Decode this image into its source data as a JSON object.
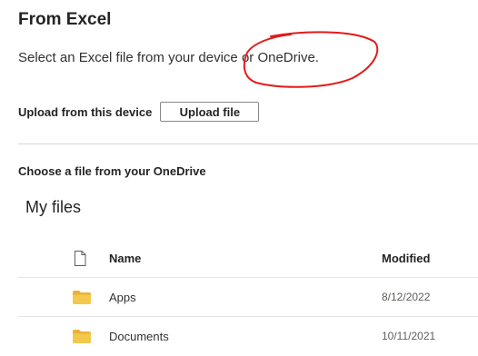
{
  "dialog": {
    "title": "From Excel",
    "subtitle": "Select an Excel file from your device or OneDrive."
  },
  "upload": {
    "label": "Upload from this device",
    "button_label": "Upload file"
  },
  "onedrive": {
    "choose_label": "Choose a file from your OneDrive",
    "section_title": "My files",
    "columns": {
      "name": "Name",
      "modified": "Modified"
    },
    "files": [
      {
        "name": "Apps",
        "modified": "8/12/2022",
        "icon": "folder-icon"
      },
      {
        "name": "Documents",
        "modified": "10/11/2021",
        "icon": "folder-icon"
      }
    ]
  },
  "colors": {
    "annotation": "#e21b1b",
    "folder": "#f2c94c",
    "folder_dark": "#e8b339",
    "divider": "#d6d6d6",
    "button_border": "#8a8886"
  },
  "icons": {
    "header": "document-icon",
    "annotation": "red-circle-annotation"
  }
}
